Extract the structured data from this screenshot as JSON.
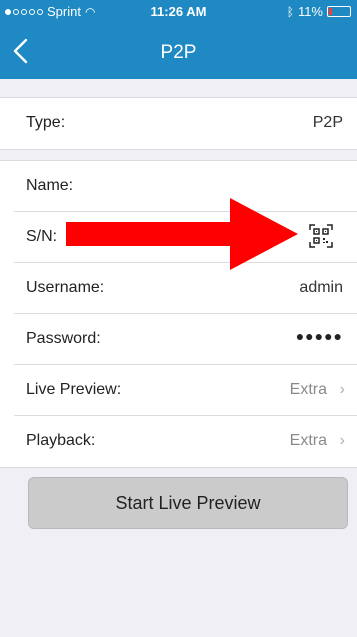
{
  "status_bar": {
    "carrier": "Sprint",
    "time": "11:26 AM",
    "battery": "11%"
  },
  "nav": {
    "title": "P2P"
  },
  "type_row": {
    "label": "Type:",
    "value": "P2P"
  },
  "fields": {
    "name_label": "Name:",
    "sn_label": "S/N:",
    "username_label": "Username:",
    "username_value": "admin",
    "password_label": "Password:",
    "password_value": "●●●●●",
    "live_preview_label": "Live Preview:",
    "live_preview_value": "Extra",
    "playback_label": "Playback:",
    "playback_value": "Extra"
  },
  "actions": {
    "start_live_preview": "Start Live Preview"
  },
  "icons": {
    "back": "chevron-left-icon",
    "qr": "qr-scan-icon",
    "chevron": "chevron-right-icon"
  },
  "colors": {
    "nav_bar": "#1e89c3",
    "annotation_arrow": "#ff0000"
  }
}
